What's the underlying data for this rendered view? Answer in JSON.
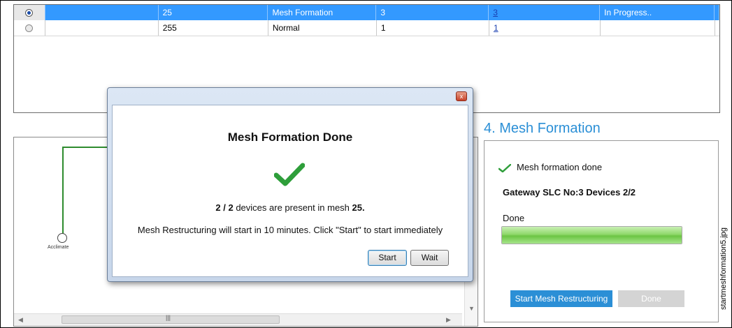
{
  "grid": {
    "rows": [
      {
        "selected": true,
        "c1": "",
        "c2": "25",
        "c3": "Mesh Formation",
        "c4": "3",
        "c5": "3",
        "c6": "In Progress..",
        "c7": ""
      },
      {
        "selected": false,
        "c1": "",
        "c2": "255",
        "c3": "Normal",
        "c4": "1",
        "c5": "1",
        "c6": "",
        "c7": ""
      }
    ]
  },
  "diagram": {
    "node_label": "Acclimate",
    "scroll_thumb_grip": "|||"
  },
  "panel": {
    "step_title": "4. Mesh Formation",
    "done_text": "Mesh formation done",
    "gateway": "Gateway SLC No:3  Devices 2/2",
    "status": "Done",
    "progress_fraction": 1.0,
    "restructure_button": "Start Mesh Restructuring",
    "done_button": "Done"
  },
  "dialog": {
    "close_glyph": "x",
    "title": "Mesh Formation Done",
    "count_done": "2",
    "count_sep": " / ",
    "count_total": "2",
    "count_mid": " devices are present in mesh ",
    "mesh_id": "25.",
    "line2": "Mesh Restructuring will start in 10 minutes.  Click \"Start\" to start immediately",
    "start_label": "Start",
    "wait_label": "Wait"
  },
  "side_caption": "startmeshformation5.jpg",
  "colors": {
    "accent": "#2b8fd6",
    "selection": "#3399ff",
    "success": "#2e9e3a"
  }
}
